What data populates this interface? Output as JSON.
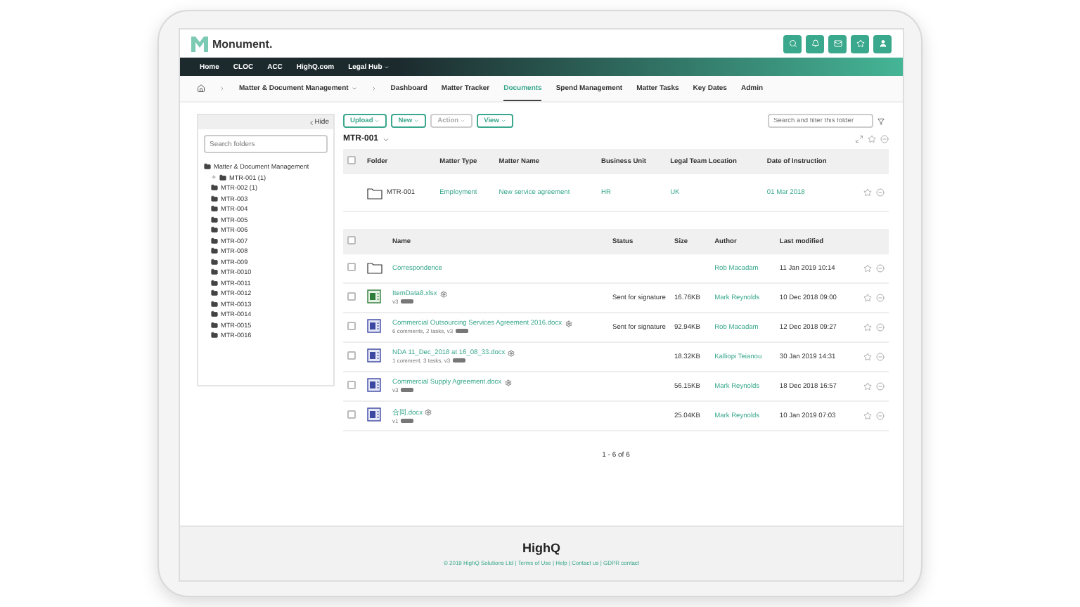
{
  "header": {
    "logo": "Monument."
  },
  "top_nav": [
    {
      "label": "Home",
      "has_menu": false
    },
    {
      "label": "CLOC",
      "has_menu": false
    },
    {
      "label": "ACC",
      "has_menu": false
    },
    {
      "label": "HighQ.com",
      "has_menu": false
    },
    {
      "label": "Legal Hub",
      "has_menu": true
    }
  ],
  "breadcrumb": {
    "section": "Matter & Document Management"
  },
  "tabs": [
    {
      "label": "Dashboard",
      "selected": false
    },
    {
      "label": "Matter Tracker",
      "selected": false
    },
    {
      "label": "Documents",
      "selected": true
    },
    {
      "label": "Spend Management",
      "selected": false
    },
    {
      "label": "Matter Tasks",
      "selected": false
    },
    {
      "label": "Key Dates",
      "selected": false
    },
    {
      "label": "Admin",
      "selected": false
    }
  ],
  "folder_panel": {
    "hide_label": "Hide",
    "search_placeholder": "Search folders",
    "tree": [
      {
        "label": "Matter & Document Management",
        "children": [
          {
            "label": "MTR-001 (1)",
            "expanded": false
          },
          {
            "label": "MTR-002 (1)"
          },
          {
            "label": "MTR-003"
          },
          {
            "label": "MTR-004"
          },
          {
            "label": "MTR-005"
          },
          {
            "label": "MTR-006"
          },
          {
            "label": "MTR-007"
          },
          {
            "label": "MTR-008"
          },
          {
            "label": "MTR-009"
          },
          {
            "label": "MTR-0010"
          },
          {
            "label": "MTR-0011"
          },
          {
            "label": "MTR-0012"
          },
          {
            "label": "MTR-0013"
          },
          {
            "label": "MTR-0014"
          },
          {
            "label": "MTR-0015"
          },
          {
            "label": "MTR-0016"
          }
        ]
      }
    ]
  },
  "toolbar": {
    "buttons": [
      {
        "label": "Upload",
        "disabled": false
      },
      {
        "label": "New",
        "disabled": false
      },
      {
        "label": "Action",
        "disabled": true
      },
      {
        "label": "View",
        "disabled": false
      }
    ],
    "search_placeholder": "Search and filter this folder"
  },
  "folder_title": "MTR-001",
  "matter_table": {
    "all_checked": false,
    "columns": [
      "Folder",
      "Matter Type",
      "Matter Name",
      "Business Unit",
      "Legal Team Location",
      "Date of Instruction"
    ],
    "rows": [
      {
        "folder": "MTR-001",
        "matter_type": "Employment",
        "matter_name": "New service agreement",
        "business_unit": "HR",
        "location": "UK",
        "date": "01 Mar 2018"
      }
    ]
  },
  "documents": {
    "all_checked": false,
    "columns": [
      "Name",
      "Status",
      "Size",
      "Author",
      "Last modified"
    ],
    "rows": [
      {
        "kind": "folder",
        "checked": false,
        "name": "Correspondence",
        "author": "Rob Macadam",
        "modified": "11 Jan 2019 10:14"
      },
      {
        "kind": "spreadsheet",
        "checked": false,
        "name": "ItemData8.xlsx",
        "meta": "v3",
        "status": "Sent for signature",
        "size": "16.76KB",
        "author": "Mark Reynolds",
        "modified": "10 Dec 2018 09:00"
      },
      {
        "kind": "document",
        "checked": false,
        "name": "Commercial Outsourcing Services Agreement 2016.docx",
        "meta": "6 comments, 2 tasks, v3",
        "status": "Sent for signature",
        "size": "92.94KB",
        "author": "Rob Macadam",
        "modified": "12 Dec 2018 09:27"
      },
      {
        "kind": "document",
        "checked": false,
        "name": "NDA 11_Dec_2018 at 16_08_33.docx",
        "meta": "1 comment, 3 tasks, v3",
        "size": "18.32KB",
        "author": "Kalliopi Teianou",
        "modified": "30 Jan 2019 14:31"
      },
      {
        "kind": "document",
        "checked": false,
        "name": "Commercial Supply Agreement.docx",
        "meta": "v3",
        "size": "56.15KB",
        "author": "Mark Reynolds",
        "modified": "18 Dec 2018 16:57"
      },
      {
        "kind": "document",
        "checked": false,
        "name": "合同.docx",
        "meta": "v1",
        "size": "25.04KB",
        "author": "Mark Reynolds",
        "modified": "10 Jan 2019 07:03"
      }
    ]
  },
  "pagination": "1 - 6 of 6",
  "footer": {
    "logo": "HighQ",
    "text": "© 2019 HighQ Solutions Ltd | Terms of Use | Help | Contact us | GDPR contact"
  }
}
